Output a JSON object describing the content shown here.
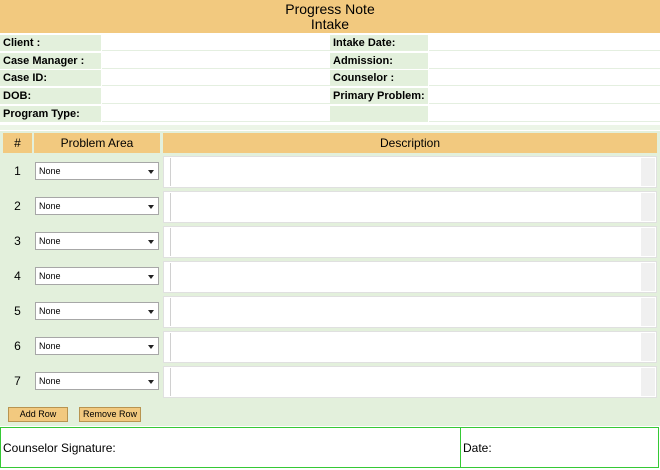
{
  "header": {
    "title": "Progress Note",
    "subtitle": "Intake"
  },
  "info": {
    "left": [
      {
        "label": "Client :",
        "value": ""
      },
      {
        "label": "Case Manager :",
        "value": ""
      },
      {
        "label": "Case ID:",
        "value": ""
      },
      {
        "label": "DOB:",
        "value": ""
      },
      {
        "label": "Program Type:",
        "value": ""
      }
    ],
    "right": [
      {
        "label": "Intake Date:",
        "value": ""
      },
      {
        "label": "Admission:",
        "value": ""
      },
      {
        "label": "Counselor :",
        "value": ""
      },
      {
        "label": "Primary Problem:",
        "value": ""
      },
      {
        "label": "",
        "value": ""
      }
    ]
  },
  "grid": {
    "columns": {
      "num": "#",
      "area": "Problem Area",
      "desc": "Description"
    },
    "rows": [
      {
        "num": "1",
        "area": "None",
        "description": ""
      },
      {
        "num": "2",
        "area": "None",
        "description": ""
      },
      {
        "num": "3",
        "area": "None",
        "description": ""
      },
      {
        "num": "4",
        "area": "None",
        "description": ""
      },
      {
        "num": "5",
        "area": "None",
        "description": ""
      },
      {
        "num": "6",
        "area": "None",
        "description": ""
      },
      {
        "num": "7",
        "area": "None",
        "description": ""
      }
    ]
  },
  "buttons": {
    "add": "Add Row",
    "remove": "Remove Row"
  },
  "signature": {
    "counselor_label": "Counselor Signature:",
    "date_label": "Date:"
  },
  "colors": {
    "header_bg": "#f2c97f",
    "label_bg": "#e3f0dc",
    "border_green": "#35c935"
  }
}
